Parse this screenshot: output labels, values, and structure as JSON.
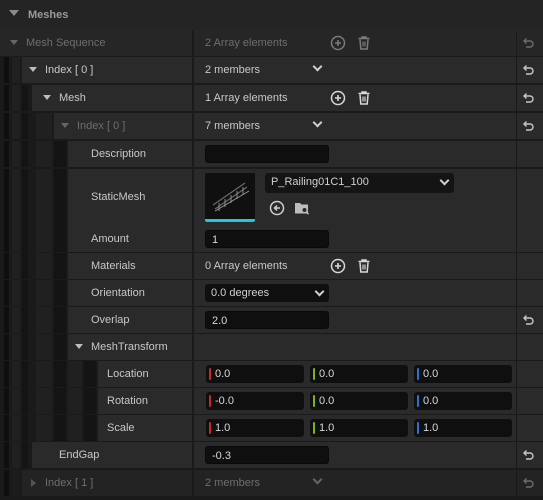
{
  "section": {
    "title": "Meshes"
  },
  "colors": {
    "x_axis": "#c62828",
    "y_axis": "#7cb518",
    "z_axis": "#2f6fd6",
    "thumb_accent": "#26c6da"
  },
  "rows": {
    "mesh_sequence": {
      "label": "Mesh Sequence",
      "value": "2 Array elements"
    },
    "index0": {
      "label": "Index [ 0 ]",
      "value": "2 members"
    },
    "mesh": {
      "label": "Mesh",
      "value": "1 Array elements"
    },
    "mesh_index0": {
      "label": "Index [ 0 ]",
      "value": "7 members"
    },
    "description": {
      "label": "Description",
      "value": ""
    },
    "static_mesh": {
      "label": "StaticMesh",
      "value": "P_Railing01C1_100"
    },
    "amount": {
      "label": "Amount",
      "value": "1"
    },
    "materials": {
      "label": "Materials",
      "value": "0 Array elements"
    },
    "orientation": {
      "label": "Orientation",
      "value": "0.0 degrees"
    },
    "overlap": {
      "label": "Overlap",
      "value": "2.0"
    },
    "mesh_transform": {
      "label": "MeshTransform"
    },
    "location": {
      "label": "Location",
      "x": "0.0",
      "y": "0.0",
      "z": "0.0"
    },
    "rotation": {
      "label": "Rotation",
      "x": "-0.0",
      "y": "0.0",
      "z": "0.0"
    },
    "scale": {
      "label": "Scale",
      "x": "1.0",
      "y": "1.0",
      "z": "1.0"
    },
    "end_gap": {
      "label": "EndGap",
      "value": "-0.3"
    },
    "index1": {
      "label": "Index [ 1 ]",
      "value": "2 members"
    }
  },
  "icons": {
    "add": "add-element-icon",
    "delete": "delete-icon",
    "reset": "reset-to-default-icon",
    "use_selected": "use-selected-asset-icon",
    "browse": "browse-asset-icon"
  }
}
